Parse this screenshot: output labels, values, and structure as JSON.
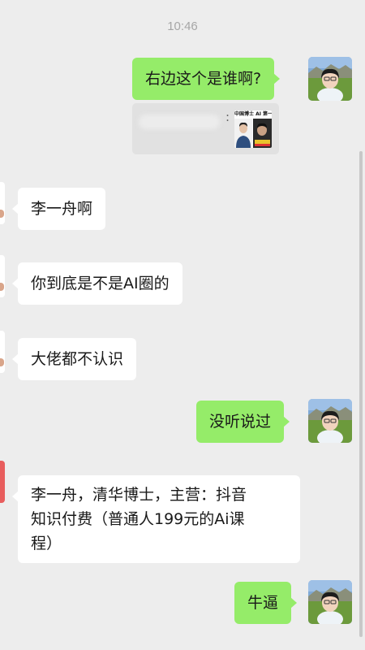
{
  "status": {
    "time": "10:46"
  },
  "messages": [
    {
      "side": "right",
      "text": "右边这个是谁啊?"
    },
    {
      "side": "left",
      "text": "李一舟啊"
    },
    {
      "side": "left",
      "text": "你到底是不是AI圈的"
    },
    {
      "side": "left",
      "text": "大佬都不认识"
    },
    {
      "side": "right",
      "text": "没听说过"
    },
    {
      "side": "left",
      "text_lines": [
        "李一舟，清华博士，主营：抖音",
        "知识付费（普通人199元的Ai课",
        "程）"
      ]
    },
    {
      "side": "right",
      "text": "牛逼"
    }
  ],
  "quote": {
    "separator": ":",
    "thumb_title": "中国博士 AI 第一"
  },
  "icons": [
    "user-avatar-icon",
    "contact-avatar-icon",
    "quoted-image-icon"
  ],
  "colors": {
    "background": "#ededed",
    "my_bubble": "#95ec69",
    "their_bubble": "#ffffff",
    "timestamp": "#a6a6a6"
  }
}
